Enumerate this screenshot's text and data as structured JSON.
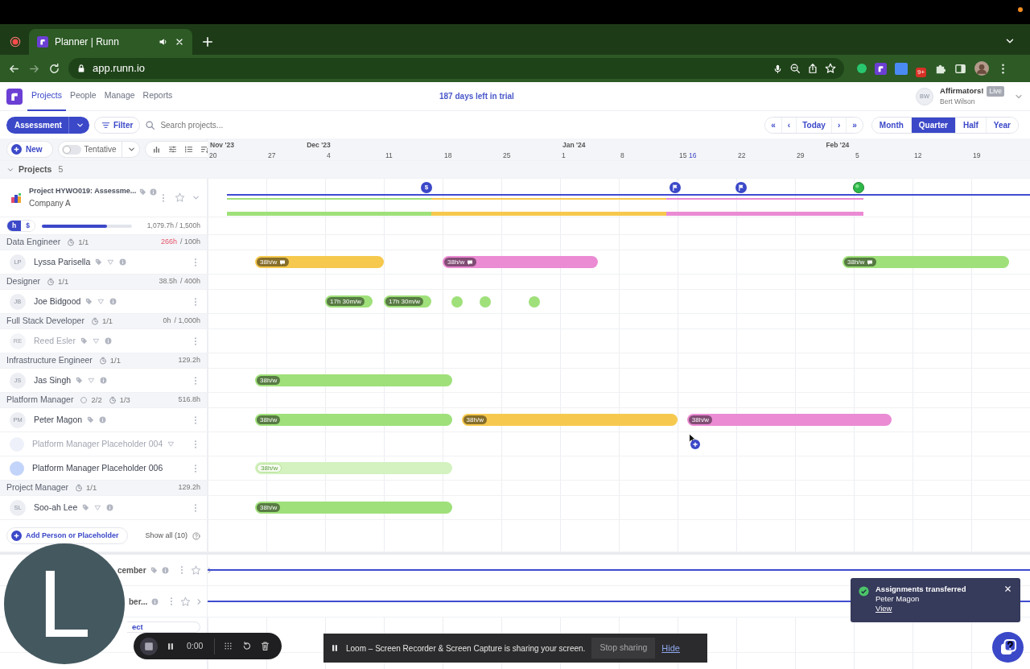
{
  "browser": {
    "tab_title": "Planner | Runn",
    "url": "app.runn.io",
    "extension_badge": "9+"
  },
  "nav": {
    "tabs": [
      {
        "label": "Projects",
        "selected": true
      },
      {
        "label": "People",
        "selected": false
      },
      {
        "label": "Manage",
        "selected": false
      },
      {
        "label": "Reports",
        "selected": false
      }
    ],
    "trial_notice": "187 days left in trial",
    "account": {
      "initials": "BW",
      "org": "Affirmators!",
      "badge": "Live",
      "user": "Bert Wilson"
    }
  },
  "toolbar": {
    "view": "Assessment",
    "filter": "Filter",
    "search_placeholder": "Search projects...",
    "date_nav": [
      {
        "label": "«"
      },
      {
        "label": "‹"
      },
      {
        "label": "Today"
      },
      {
        "label": "›"
      },
      {
        "label": "»"
      }
    ],
    "scales": [
      {
        "label": "Month",
        "selected": false
      },
      {
        "label": "Quarter",
        "selected": true
      },
      {
        "label": "Half",
        "selected": false
      },
      {
        "label": "Year",
        "selected": false
      }
    ]
  },
  "planner_tools": {
    "new": "New",
    "tentative": {
      "label": "Tentative",
      "on": false
    }
  },
  "timeline": {
    "months": [
      {
        "label": "Nov '23"
      },
      {
        "label": "Dec '23"
      },
      {
        "label": "Jan '24"
      },
      {
        "label": "Feb '24"
      }
    ],
    "days": [
      {
        "label": "20",
        "today": false
      },
      {
        "label": "27",
        "today": false
      },
      {
        "label": "4",
        "today": false
      },
      {
        "label": "11",
        "today": false
      },
      {
        "label": "18",
        "today": false
      },
      {
        "label": "25",
        "today": false
      },
      {
        "label": "1",
        "today": false
      },
      {
        "label": "8",
        "today": false
      },
      {
        "label": "15",
        "today": false
      },
      {
        "label": "16",
        "today": true
      },
      {
        "label": "22",
        "today": false
      },
      {
        "label": "29",
        "today": false
      },
      {
        "label": "5",
        "today": false
      },
      {
        "label": "12",
        "today": false
      },
      {
        "label": "19",
        "today": false
      }
    ]
  },
  "projects_header": {
    "label": "Projects",
    "count": "5",
    "expanded": true
  },
  "project": {
    "name": "Project HYWO019: Assessme...",
    "client": "Company A",
    "milestones": [
      {
        "kind": "budget",
        "symbol": "$"
      },
      {
        "kind": "flag"
      },
      {
        "kind": "flag"
      },
      {
        "kind": "done"
      }
    ],
    "phases": [
      {
        "color": "#9fe07a"
      },
      {
        "color": "#f6c94e"
      },
      {
        "color": "#eb8bd3"
      }
    ]
  },
  "budget": {
    "units": [
      {
        "label": "h",
        "selected": true
      },
      {
        "label": "$",
        "selected": false
      }
    ],
    "level": 0.72,
    "reading": "1,079.7h / 1,500h"
  },
  "roles": [
    {
      "name": "Data Engineer",
      "counts": [
        {
          "kind": "clock",
          "text": "1/1"
        }
      ],
      "used": "266h",
      "total": "/ 100h",
      "over": true,
      "people": [
        {
          "kind": "person",
          "initials": "LP",
          "name": "Lyssa Parisella",
          "dimmed": false,
          "icons": [
            {
              "kind": "tag"
            },
            {
              "kind": "triangle"
            },
            {
              "kind": "info"
            }
          ],
          "bars": [
            {
              "kind": "bar",
              "label": "38h/w",
              "comment": true,
              "tentative": false,
              "color": "#f6c94e"
            },
            {
              "kind": "bar",
              "label": "38h/w",
              "comment": true,
              "tentative": false,
              "color": "#eb8bd3"
            },
            {
              "kind": "bar",
              "label": "38h/w",
              "comment": true,
              "tentative": false,
              "color": "#9fe07a"
            }
          ]
        }
      ]
    },
    {
      "name": "Designer",
      "counts": [
        {
          "kind": "clock",
          "text": "1/1"
        }
      ],
      "used": "38.5h",
      "total": "/ 400h",
      "over": false,
      "people": [
        {
          "kind": "person",
          "initials": "JB",
          "name": "Joe Bidgood",
          "dimmed": false,
          "icons": [
            {
              "kind": "tag"
            },
            {
              "kind": "triangle"
            },
            {
              "kind": "info"
            }
          ],
          "bars": [
            {
              "kind": "bar",
              "label": "17h 30m/w",
              "comment": false,
              "tentative": false,
              "color": "#9fe07a"
            },
            {
              "kind": "bar",
              "label": "17h 30m/w",
              "comment": false,
              "tentative": false,
              "color": "#9fe07a"
            },
            {
              "kind": "dot",
              "color": "#9fe07a"
            },
            {
              "kind": "dot",
              "color": "#9fe07a"
            },
            {
              "kind": "dot",
              "color": "#9fe07a"
            }
          ]
        }
      ]
    },
    {
      "name": "Full Stack Developer",
      "counts": [
        {
          "kind": "clock",
          "text": "1/1"
        }
      ],
      "used": "0h",
      "total": "/ 1,000h",
      "over": false,
      "people": [
        {
          "kind": "person",
          "initials": "RE",
          "name": "Reed Esler",
          "dimmed": true,
          "icons": [
            {
              "kind": "tag"
            },
            {
              "kind": "triangle"
            },
            {
              "kind": "info"
            }
          ]
        }
      ]
    },
    {
      "name": "Infrastructure Engineer",
      "counts": [
        {
          "kind": "clock",
          "text": "1/1"
        }
      ],
      "used": "129.2h",
      "over": false,
      "people": [
        {
          "kind": "person",
          "initials": "JS",
          "name": "Jas Singh",
          "dimmed": false,
          "icons": [
            {
              "kind": "tag"
            },
            {
              "kind": "triangle"
            },
            {
              "kind": "info"
            }
          ],
          "bars": [
            {
              "kind": "bar",
              "label": "38h/w",
              "comment": false,
              "tentative": false,
              "color": "#9fe07a"
            }
          ]
        }
      ]
    },
    {
      "name": "Platform Manager",
      "counts": [
        {
          "kind": "placeholder",
          "text": "2/2"
        },
        {
          "kind": "clock",
          "text": "1/3"
        }
      ],
      "used": "516.8h",
      "over": false,
      "people": [
        {
          "kind": "person",
          "initials": "PM",
          "name": "Peter Magon",
          "dimmed": false,
          "icons": [
            {
              "kind": "tag"
            },
            {
              "kind": "info"
            }
          ],
          "bars": [
            {
              "kind": "bar",
              "label": "38h/w",
              "comment": false,
              "tentative": false,
              "color": "#9fe07a"
            },
            {
              "kind": "bar",
              "label": "38h/w",
              "comment": false,
              "tentative": false,
              "color": "#f6c94e"
            },
            {
              "kind": "bar",
              "label": "38h/w",
              "comment": false,
              "tentative": false,
              "color": "#eb8bd3"
            }
          ]
        },
        {
          "kind": "placeholder",
          "name": "Platform Manager Placeholder 004",
          "dimmed": true,
          "icons": [
            {
              "kind": "triangle"
            }
          ]
        },
        {
          "kind": "placeholder",
          "name": "Platform Manager Placeholder 006",
          "dimmed": false,
          "bars": [
            {
              "kind": "bar",
              "label": "38h/w",
              "comment": false,
              "tentative": true,
              "color": "#d3f2bf"
            }
          ]
        }
      ]
    },
    {
      "name": "Project Manager",
      "counts": [
        {
          "kind": "clock",
          "text": "1/1"
        }
      ],
      "used": "129.2h",
      "over": false,
      "people": [
        {
          "kind": "person",
          "initials": "SL",
          "name": "Soo-ah Lee",
          "dimmed": false,
          "icons": [
            {
              "kind": "tag"
            },
            {
              "kind": "triangle"
            },
            {
              "kind": "info"
            }
          ],
          "bars": [
            {
              "kind": "bar",
              "label": "38h/w",
              "comment": false,
              "tentative": false,
              "color": "#9fe07a"
            }
          ]
        }
      ]
    }
  ],
  "add_person": "Add Person or Placeholder",
  "show_all": "Show all (10)",
  "collapsed_projects": [
    {
      "name": "cember",
      "icons": [
        {
          "kind": "tag"
        },
        {
          "kind": "info"
        }
      ]
    },
    {
      "name": "ber...",
      "icons": [
        {
          "kind": "info"
        }
      ]
    }
  ],
  "add_project": "ect",
  "loom": {
    "bubble_initial": "L",
    "timer": "0:00",
    "share_message": "Loom – Screen Recorder & Screen Capture is sharing your screen.",
    "stop": "Stop sharing",
    "hide": "Hide"
  },
  "toast": {
    "title": "Assignments transferred",
    "body": "Peter Magon",
    "link": "View"
  }
}
